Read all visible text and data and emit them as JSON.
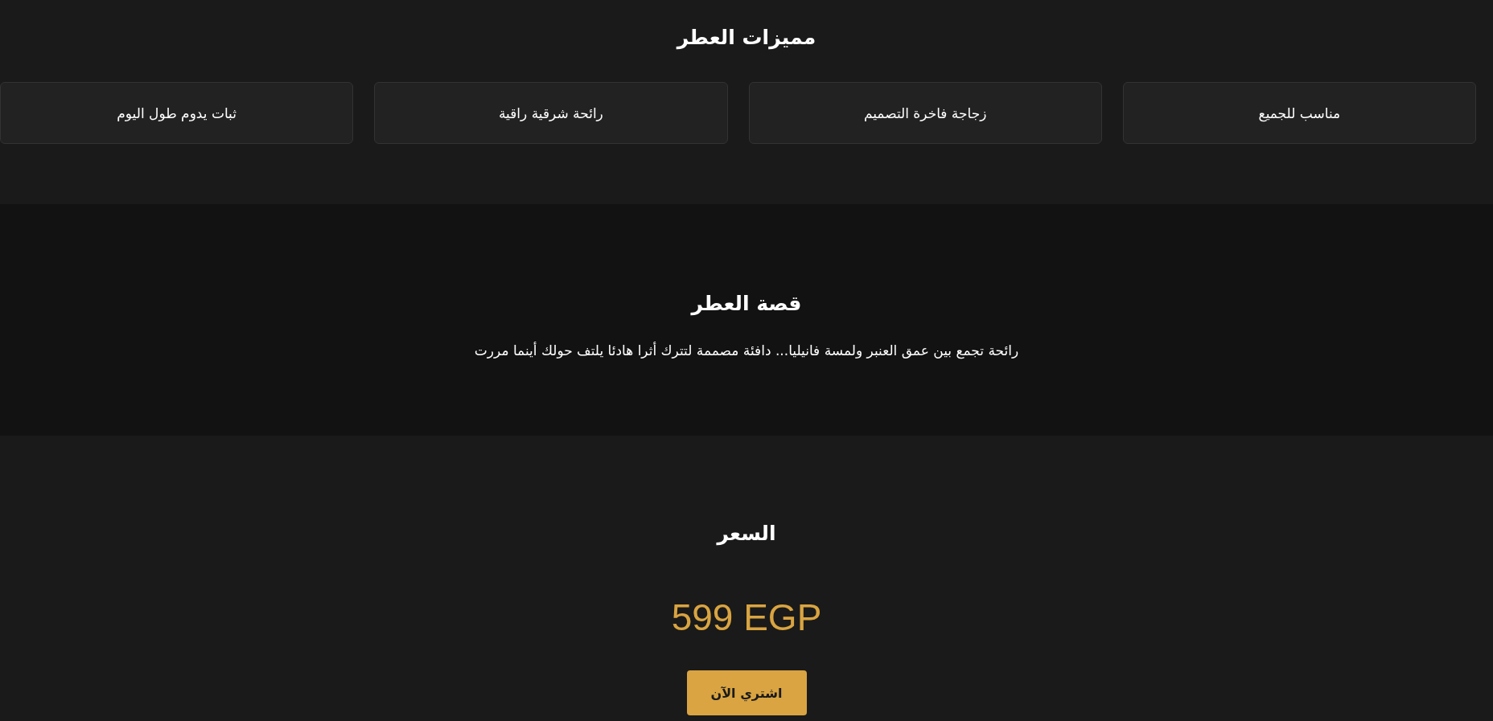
{
  "features": {
    "title": "مميزات العطر",
    "items": [
      {
        "label": "مناسب للجميع"
      },
      {
        "label": "زجاجة فاخرة التصميم"
      },
      {
        "label": "رائحة شرقية راقية"
      },
      {
        "label": "ثبات يدوم طول اليوم"
      }
    ]
  },
  "story": {
    "title": "قصة العطر",
    "text": "رائحة تجمع بين عمق العنبر ولمسة فانيليا... دافئة مصممة لتترك أثرا هادئا يلتف حولك أينما مررت"
  },
  "price": {
    "title": "السعر",
    "amount": "599 EGP",
    "button": "اشتري الآن"
  }
}
